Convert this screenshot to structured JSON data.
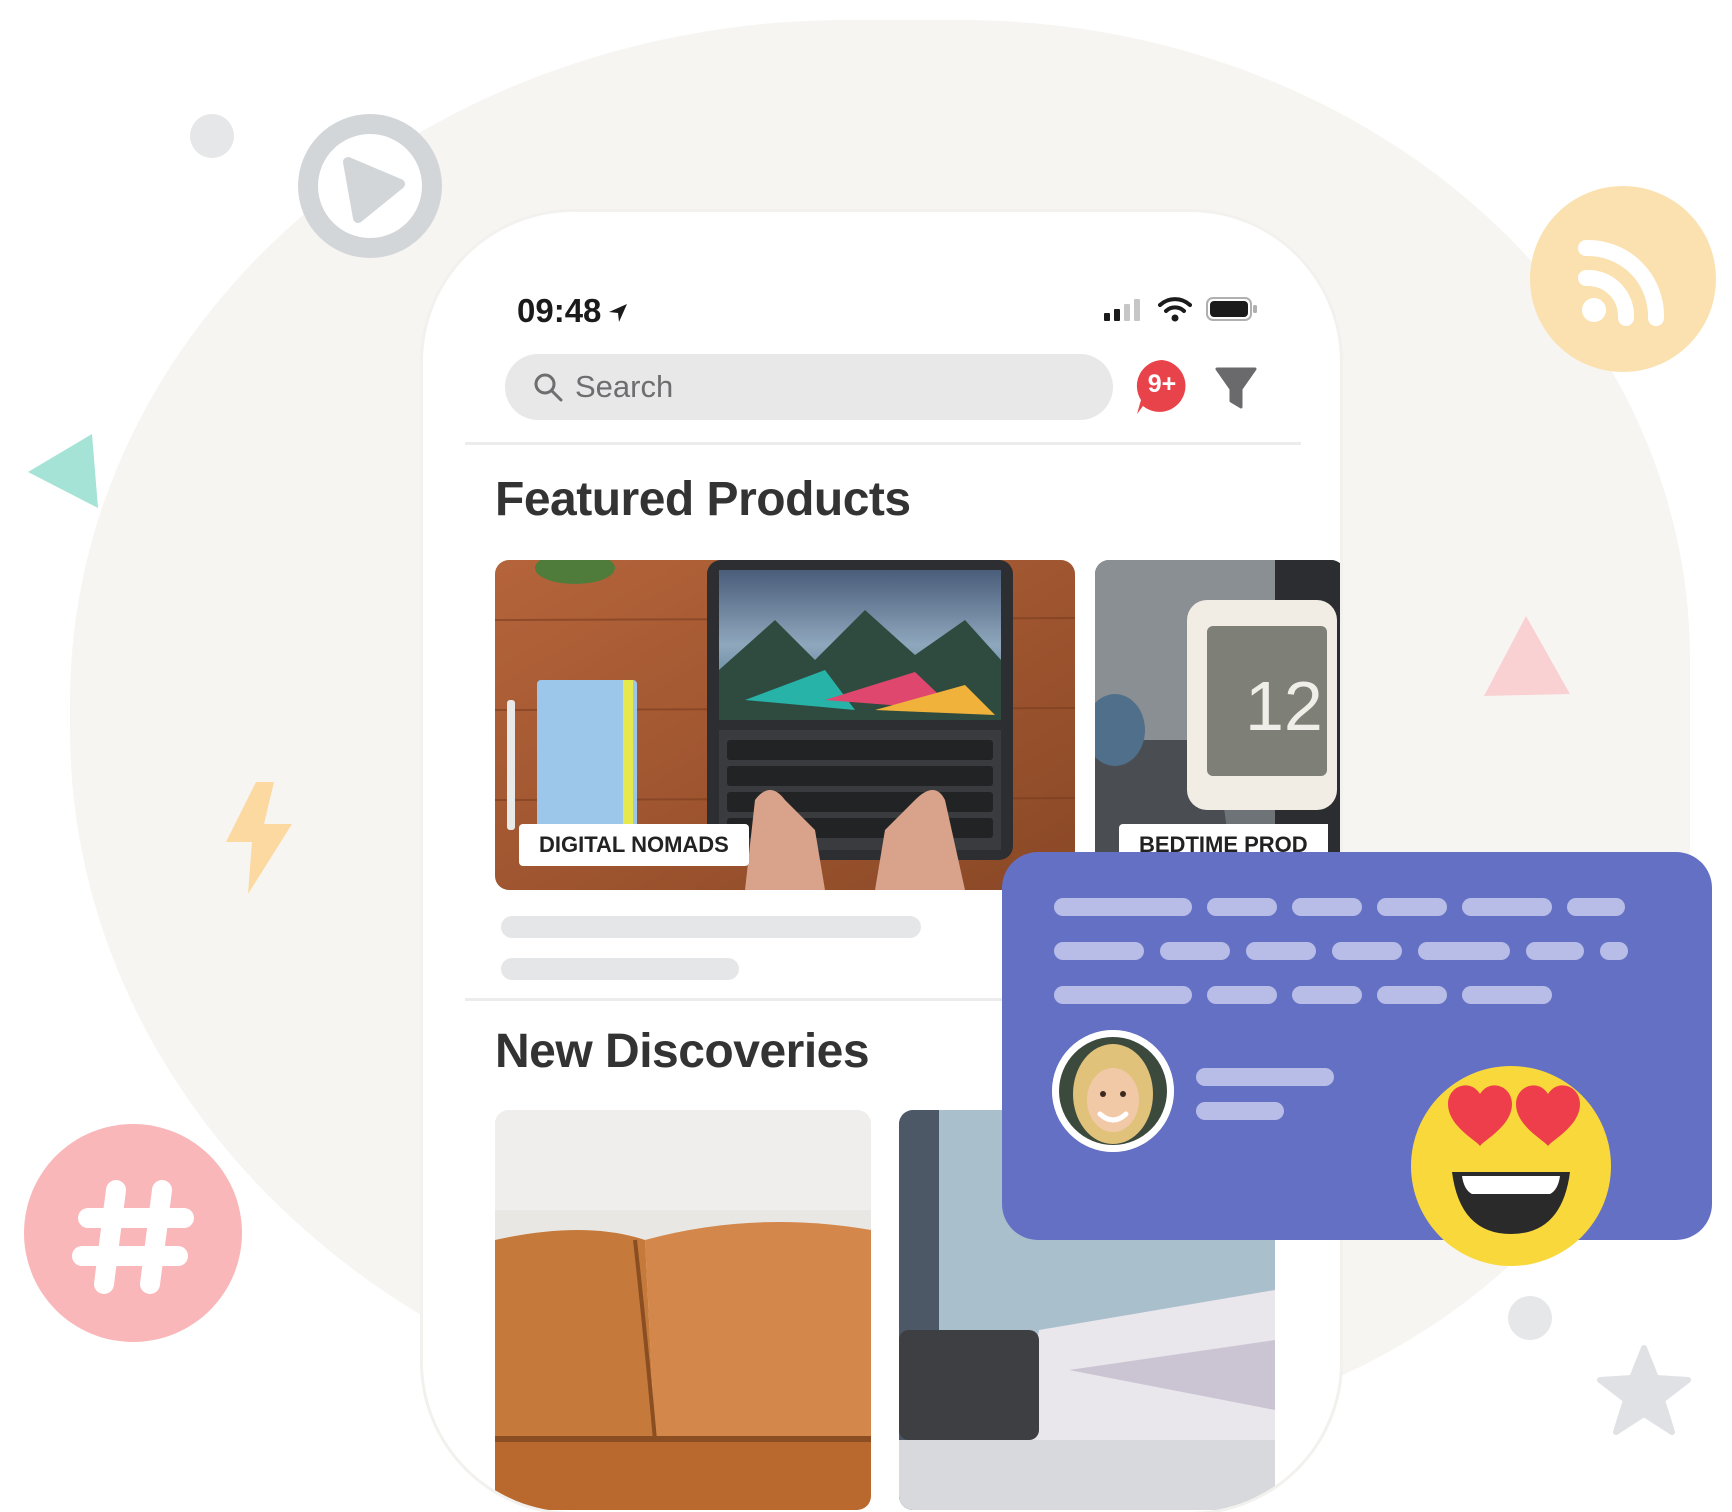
{
  "status_bar": {
    "time": "09:48"
  },
  "search": {
    "placeholder": "Search"
  },
  "notifications": {
    "badge": "9+"
  },
  "sections": {
    "featured": {
      "title": "Featured Products",
      "cards": [
        {
          "label": "DIGITAL NOMADS"
        },
        {
          "label": "BEDTIME PROD"
        }
      ]
    },
    "discoveries": {
      "title": "New Discoveries"
    }
  },
  "colors": {
    "notification_badge": "#e8424a",
    "chat_card": "#6470c4",
    "chat_lines": "#b7bde6",
    "rss_circle": "#fbe1b0",
    "hashtag_circle": "#f9b7b9",
    "play_circle": "#d3d6d8"
  },
  "icons": [
    "play-icon",
    "rss-icon",
    "hashtag-icon",
    "star-icon",
    "lightning-icon",
    "triangle-icon",
    "search-icon",
    "filter-icon",
    "location-arrow-icon",
    "wifi-icon",
    "battery-icon",
    "signal-icon",
    "heart-eyes-emoji"
  ]
}
